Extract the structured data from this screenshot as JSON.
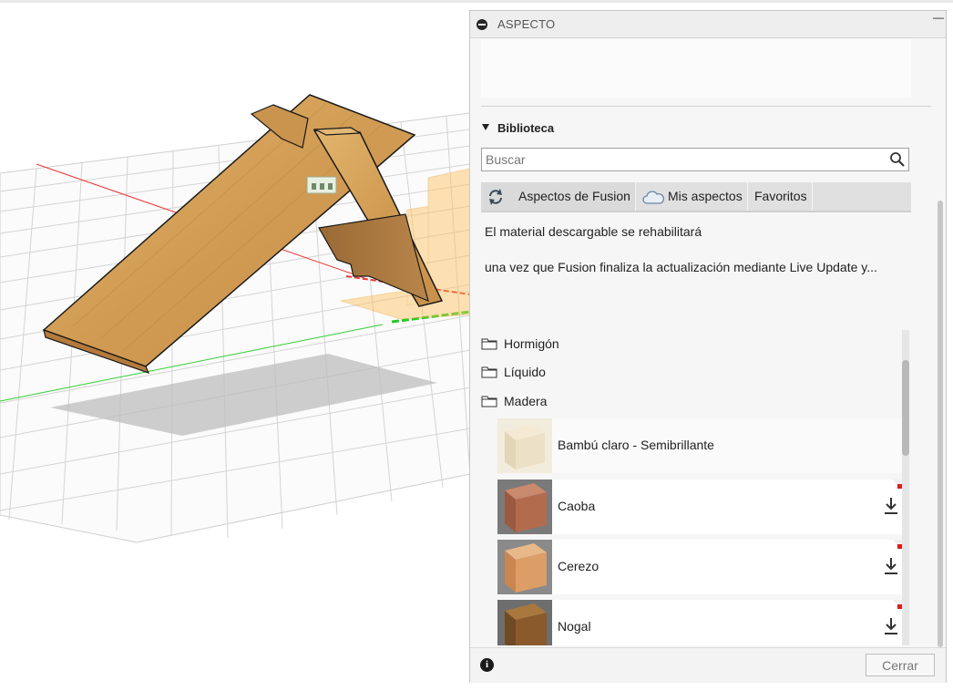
{
  "panel": {
    "title": "ASPECTO",
    "library_title": "Biblioteca",
    "search": {
      "placeholder": "Buscar",
      "value": ""
    },
    "tabs": [
      {
        "label": "Aspectos de Fusion",
        "icon": "refresh-icon",
        "active": true
      },
      {
        "label": "Mis aspectos",
        "icon": "cloud-icon"
      },
      {
        "label": "Favoritos"
      }
    ],
    "messages": [
      "El material descargable se rehabilitará",
      "una vez que Fusion finaliza la actualización mediante Live Update y..."
    ],
    "folders": [
      "Hormigón",
      "Líquido",
      "Madera"
    ],
    "materials": [
      {
        "label": "Bambú claro - Semibrillante",
        "downloadable": false,
        "thumb_color": "#ece2cf"
      },
      {
        "label": "Caoba",
        "downloadable": true,
        "thumb_color": "#b5694d"
      },
      {
        "label": "Cerezo",
        "downloadable": true,
        "thumb_color": "#d69b66"
      },
      {
        "label": "Nogal",
        "downloadable": true,
        "thumb_color": "#8a5a2c"
      }
    ],
    "close_label": "Cerrar"
  },
  "colors": {
    "wood": "#d7a961",
    "selection_orange": "#ffb84a",
    "x_axis": "#e33",
    "y_axis": "#2c2"
  }
}
